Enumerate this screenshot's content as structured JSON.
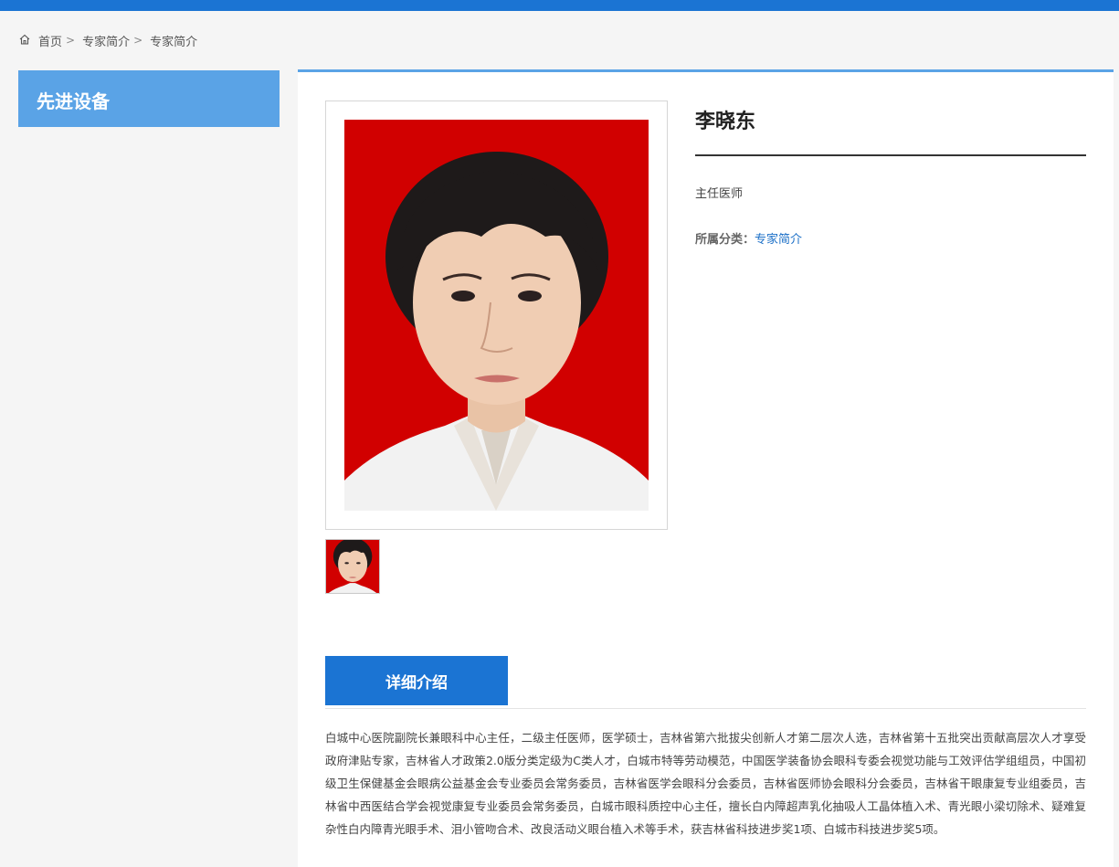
{
  "breadcrumb": {
    "home": "首页",
    "level1": "专家简介",
    "level2": "专家简介"
  },
  "sidebar": {
    "title": "先进设备"
  },
  "profile": {
    "name": "李晓东",
    "title": "主任医师",
    "category_label": "所属分类：",
    "category_value": "专家简介"
  },
  "detail": {
    "tab_label": "详细介绍",
    "text": "白城中心医院副院长兼眼科中心主任，二级主任医师，医学硕士，吉林省第六批拔尖创新人才第二层次人选，吉林省第十五批突出贡献高层次人才享受政府津贴专家，吉林省人才政策2.0版分类定级为C类人才，白城市特等劳动模范，中国医学装备协会眼科专委会视觉功能与工效评估学组组员，中国初级卫生保健基金会眼病公益基金会专业委员会常务委员，吉林省医学会眼科分会委员，吉林省医师协会眼科分会委员，吉林省干眼康复专业组委员，吉林省中西医结合学会视觉康复专业委员会常务委员，白城市眼科质控中心主任，擅长白内障超声乳化抽吸人工晶体植入术、青光眼小梁切除术、疑难复杂性白内障青光眼手术、泪小管吻合术、改良活动义眼台植入术等手术，获吉林省科技进步奖1项、白城市科技进步奖5项。"
  },
  "colors": {
    "accent": "#1b74d3",
    "sidebar": "#5aa3e6",
    "photo_bg": "#d10000"
  },
  "icons": {
    "home": "home-icon",
    "separator": "chevron-right-icon"
  }
}
